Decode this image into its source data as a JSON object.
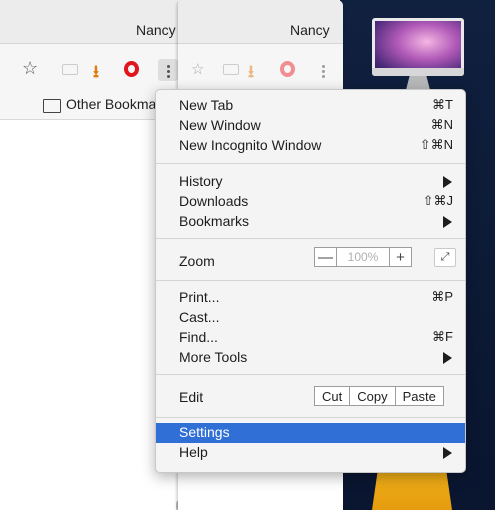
{
  "desktop": {
    "accent": "#10203f"
  },
  "back_window": {
    "profile_name": "Nancy",
    "bookmark_folder": "Other Bookma"
  },
  "front_window": {
    "profile_name": "Nancy"
  },
  "menu": {
    "new_tab": {
      "label": "New Tab",
      "shortcut": "⌘T"
    },
    "new_window": {
      "label": "New Window",
      "shortcut": "⌘N"
    },
    "new_incognito": {
      "label": "New Incognito Window",
      "shortcut": "⇧⌘N"
    },
    "history": {
      "label": "History"
    },
    "downloads": {
      "label": "Downloads",
      "shortcut": "⇧⌘J"
    },
    "bookmarks": {
      "label": "Bookmarks"
    },
    "zoom": {
      "label": "Zoom",
      "minus": "—",
      "value": "100%",
      "plus": "+",
      "fullscreen": "⤢"
    },
    "print": {
      "label": "Print...",
      "shortcut": "⌘P"
    },
    "cast": {
      "label": "Cast..."
    },
    "find": {
      "label": "Find...",
      "shortcut": "⌘F"
    },
    "more_tools": {
      "label": "More Tools"
    },
    "edit": {
      "label": "Edit",
      "cut": "Cut",
      "copy": "Copy",
      "paste": "Paste"
    },
    "settings": {
      "label": "Settings"
    },
    "help": {
      "label": "Help"
    },
    "highlight_color": "#2f6fd6"
  }
}
